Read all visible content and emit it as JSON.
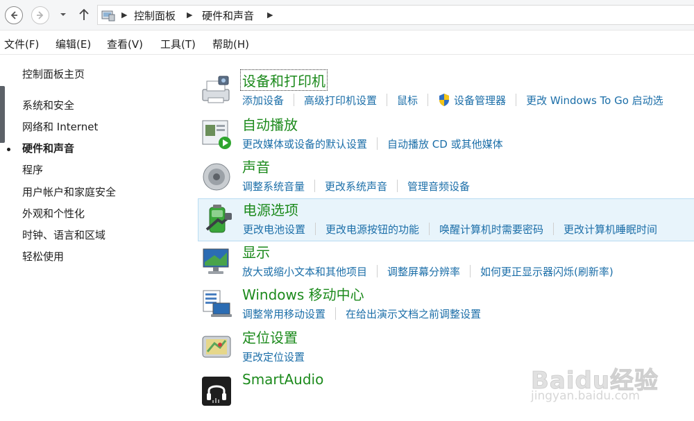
{
  "breadcrumb": [
    "控制面板",
    "硬件和声音"
  ],
  "menu": [
    "文件(F)",
    "编辑(E)",
    "查看(V)",
    "工具(T)",
    "帮助(H)"
  ],
  "sidebar": {
    "home": "控制面板主页",
    "items": [
      {
        "label": "系统和安全"
      },
      {
        "label": "网络和 Internet"
      },
      {
        "label": "硬件和声音"
      },
      {
        "label": "程序"
      },
      {
        "label": "用户帐户和家庭安全"
      },
      {
        "label": "外观和个性化"
      },
      {
        "label": "时钟、语言和区域"
      },
      {
        "label": "轻松使用"
      }
    ]
  },
  "categories": [
    {
      "title": "设备和打印机",
      "icon": "printer-device-icon",
      "links": [
        "添加设备",
        "高级打印机设置",
        "鼠标",
        "设备管理器",
        "更改 Windows To Go 启动选"
      ]
    },
    {
      "title": "自动播放",
      "icon": "autoplay-icon",
      "links": [
        "更改媒体或设备的默认设置",
        "自动播放 CD 或其他媒体"
      ]
    },
    {
      "title": "声音",
      "icon": "speaker-icon",
      "links": [
        "调整系统音量",
        "更改系统声音",
        "管理音频设备"
      ]
    },
    {
      "title": "电源选项",
      "icon": "battery-power-icon",
      "links": [
        "更改电池设置",
        "更改电源按钮的功能",
        "唤醒计算机时需要密码",
        "更改计算机睡眠时间"
      ]
    },
    {
      "title": "显示",
      "icon": "monitor-icon",
      "links": [
        "放大或缩小文本和其他项目",
        "调整屏幕分辨率",
        "如何更正显示器闪烁(刷新率)"
      ]
    },
    {
      "title": "Windows 移动中心",
      "icon": "mobility-center-icon",
      "links": [
        "调整常用移动设置",
        "在给出演示文档之前调整设置"
      ]
    },
    {
      "title": "定位设置",
      "icon": "location-icon",
      "links": [
        "更改定位设置"
      ]
    },
    {
      "title": "SmartAudio",
      "icon": "headphones-icon",
      "links": []
    }
  ],
  "watermark": {
    "main": "Baidu经验",
    "sub": "jingyan.baidu.com"
  },
  "colors": {
    "title_green": "#1c8a1c",
    "link_blue": "#1b6ea8",
    "highlight": "#e8f4fb"
  }
}
